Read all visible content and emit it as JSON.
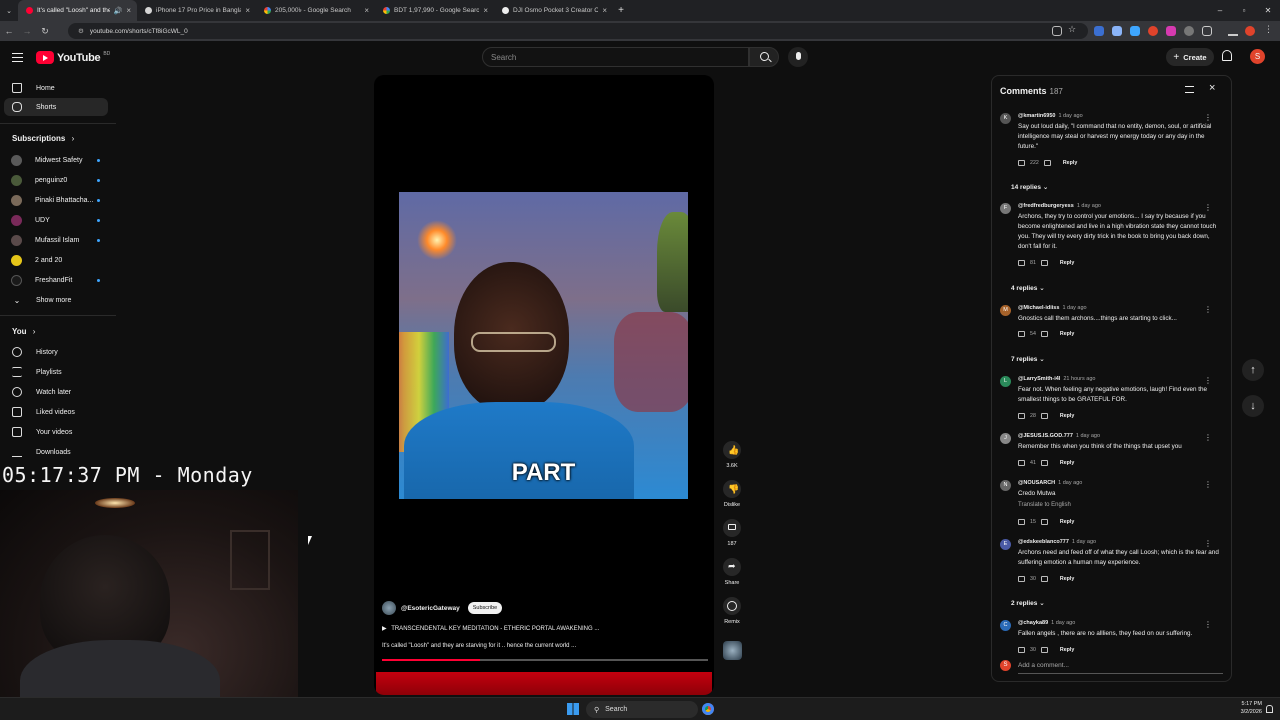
{
  "browser": {
    "tabs": [
      {
        "title": "It's called \"Loosh\" and they",
        "icon": "youtube",
        "active": true
      },
      {
        "title": "iPhone 17 Pro Price in Banglade",
        "icon": "generic",
        "active": false
      },
      {
        "title": "205,000৳ - Google Search",
        "icon": "google",
        "active": false
      },
      {
        "title": "BDT 1,97,990 - Google Search",
        "icon": "google",
        "active": false
      },
      {
        "title": "DJI Osmo Pocket 3 Creator Com",
        "icon": "generic",
        "active": false
      }
    ],
    "url": "youtube.com/shorts/cTf8iGcWL_0"
  },
  "masthead": {
    "logo_word": "YouTube",
    "logo_country": "BD",
    "search_placeholder": "Search",
    "create_label": "Create",
    "avatar_letter": "S"
  },
  "sidebar": {
    "main": [
      {
        "label": "Home",
        "icon": "home-icon"
      },
      {
        "label": "Shorts",
        "icon": "shorts-icon",
        "active": true
      }
    ],
    "subscriptions_title": "Subscriptions",
    "subscriptions": [
      {
        "label": "Midwest Safety",
        "color": "#5a5a5a"
      },
      {
        "label": "penguinz0",
        "color": "#4a5a3a"
      },
      {
        "label": "Pinaki Bhattacha...",
        "color": "#7a6a5a"
      },
      {
        "label": "UDY",
        "color": "#7a2a5a"
      },
      {
        "label": "Mufassil Islam",
        "color": "#5a4a4a"
      },
      {
        "label": "2 and 20",
        "color": "#e6c619"
      },
      {
        "label": "FreshandFit",
        "color": "#1a1a1a"
      }
    ],
    "show_more": "Show more",
    "you_title": "You",
    "you": [
      {
        "label": "History",
        "icon": "history-icon"
      },
      {
        "label": "Playlists",
        "icon": "playlists-icon"
      },
      {
        "label": "Watch later",
        "icon": "watch-later-icon"
      },
      {
        "label": "Liked videos",
        "icon": "liked-videos-icon"
      },
      {
        "label": "Your videos",
        "icon": "your-videos-icon"
      },
      {
        "label": "Downloads",
        "icon": "downloads-icon"
      }
    ]
  },
  "overlay": {
    "clock": "05:17:37 PM - Monday"
  },
  "short": {
    "overlay_text": "PART",
    "channel": "@EsotericGateway",
    "subscribe_label": "Subscribe",
    "track": "TRANSCENDENTAL KEY MEDITATION - ETHERIC PORTAL AWAKENING ...",
    "caption": "It's called \"Loosh\" and they are starving for it .. hence the current world ...",
    "progress": 0.3,
    "actions": {
      "likes": "3.6K",
      "dislike": "Dislike",
      "comments": "187",
      "share": "Share",
      "remix": "Remix"
    }
  },
  "comments": {
    "title": "Comments",
    "count": "187",
    "add_placeholder": "Add a comment...",
    "items": [
      {
        "avatar": "K",
        "color": "#555",
        "author": "@kmartin6950",
        "time": "1 day ago",
        "text": "Say out loud daily, \"I command that no entity, demon, soul, or artificial intelligence may steal or harvest my energy today or any day in the future.\"",
        "likes": "222",
        "replies": "14 replies"
      },
      {
        "avatar": "F",
        "color": "#777",
        "author": "@fredfredburgeryess",
        "time": "1 day ago",
        "text": "Archons, they try to control your emotions... I say try because if you become enlightened and live in a high vibration state they cannot touch you. They will try every dirty trick in the book to bring you back down, don't fall for it.",
        "likes": "81",
        "replies": "4 replies"
      },
      {
        "avatar": "M",
        "color": "#a6622a",
        "author": "@Michael-idiiss",
        "time": "1 day ago",
        "text": "Gnostics call them archons....things are starting to click...",
        "likes": "54",
        "replies": "7 replies"
      },
      {
        "avatar": "L",
        "color": "#2a8a5a",
        "author": "@LarrySmith-i4l",
        "time": "21 hours ago",
        "text": "Fear not. When feeling any negative emotions, laugh! Find even the smallest things to be GRATEFUL FOR.",
        "likes": "28",
        "replies": ""
      },
      {
        "avatar": "J",
        "color": "#888",
        "author": "@JESUS.IS.GOD.777",
        "time": "1 day ago",
        "text": "Remember this when you think of the things that upset you",
        "likes": "41",
        "replies": ""
      },
      {
        "avatar": "N",
        "color": "#666",
        "author": "@NOUSARCH",
        "time": "1 day ago",
        "text": "Credo Mutwa",
        "translate": "Translate to English",
        "likes": "15",
        "replies": ""
      },
      {
        "avatar": "E",
        "color": "#4a5aa6",
        "author": "@edskeeblanco777",
        "time": "1 day ago",
        "text": "Archons need and feed off of what they call Loosh; which is the fear and suffering emotion a human may experience.",
        "likes": "30",
        "replies": "2 replies"
      },
      {
        "avatar": "C",
        "color": "#2a6ab6",
        "author": "@chayka89",
        "time": "1 day ago",
        "text": "Fallen angels , there are no allliens, they feed on our suffering.",
        "likes": "30",
        "replies": ""
      }
    ],
    "reply_label": "Reply"
  },
  "taskbar": {
    "search_label": "Search",
    "time": "5:17 PM",
    "date": "3/2/2026"
  }
}
